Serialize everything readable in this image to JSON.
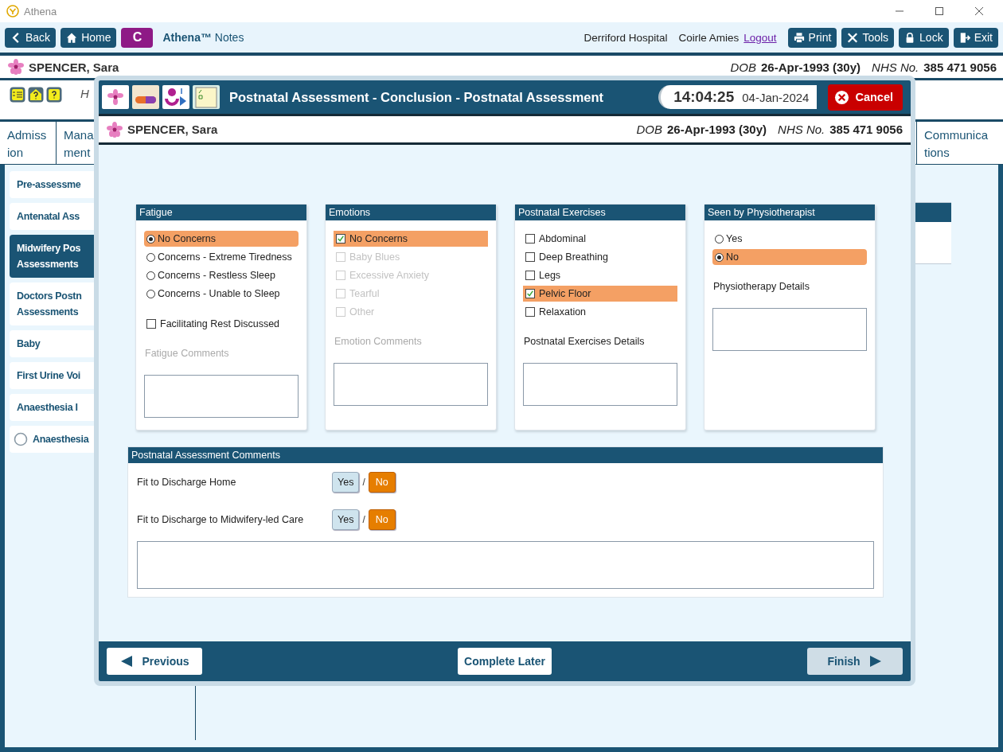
{
  "window": {
    "title": "Athena"
  },
  "toolbar": {
    "back": "Back",
    "home": "Home",
    "c_badge": "C",
    "app_name": "Athena™",
    "app_sub": "Notes",
    "hospital": "Derriford Hospital",
    "user": "Coirle Amies",
    "logout": "Logout",
    "buttons": [
      {
        "kind": "print",
        "label": "Print"
      },
      {
        "kind": "tools",
        "label": "Tools"
      },
      {
        "kind": "lock",
        "label": "Lock"
      },
      {
        "kind": "exit",
        "label": "Exit"
      }
    ]
  },
  "patient": {
    "name": "SPENCER, Sara",
    "dob_label": "DOB",
    "dob": "26-Apr-1993 (30y)",
    "nhs_label": "NHS No.",
    "nhs": "385 471 9056"
  },
  "background_heading": "H",
  "tabs": [
    {
      "lines": [
        "Admiss",
        "ion"
      ]
    },
    {
      "lines": [
        "Mana",
        "ment"
      ]
    }
  ],
  "tabs_right": [
    {
      "lines": [
        "Communica",
        "tions"
      ]
    }
  ],
  "sidebar": {
    "items": [
      {
        "lines": [
          "Pre-assessme"
        ],
        "selected": false,
        "circle": false
      },
      {
        "lines": [
          "Antenatal Ass"
        ],
        "selected": false,
        "circle": false
      },
      {
        "lines": [
          "Midwifery Pos",
          "Assessments"
        ],
        "selected": true,
        "circle": false
      },
      {
        "lines": [
          "Doctors Postn",
          "Assessments"
        ],
        "selected": false,
        "circle": false
      },
      {
        "lines": [
          "Baby"
        ],
        "selected": false,
        "circle": false
      },
      {
        "lines": [
          "First Urine Voi"
        ],
        "selected": false,
        "circle": false
      },
      {
        "lines": [
          "Anaesthesia I"
        ],
        "selected": false,
        "circle": false
      },
      {
        "lines": [
          "Anaesthesia"
        ],
        "selected": false,
        "circle": true
      }
    ]
  },
  "dialog": {
    "title": "Postnatal Assessment - Conclusion - Postnatal Assessment",
    "time": "14:04:25",
    "date": "04-Jan-2024",
    "cancel": "Cancel",
    "patient": {
      "name": "SPENCER, Sara",
      "dob_label": "DOB",
      "dob": "26-Apr-1993 (30y)",
      "nhs_label": "NHS No.",
      "nhs": "385 471 9056"
    },
    "cards": [
      {
        "title": "Fatigue",
        "options": [
          {
            "kind": "radio",
            "label": "No Concerns",
            "selected": true,
            "disabled": false
          },
          {
            "kind": "radio",
            "label": "Concerns - Extreme Tiredness",
            "selected": false,
            "disabled": false
          },
          {
            "kind": "radio",
            "label": "Concerns - Restless Sleep",
            "selected": false,
            "disabled": false
          },
          {
            "kind": "radio",
            "label": "Concerns - Unable to Sleep",
            "selected": false,
            "disabled": false
          }
        ],
        "extra": [
          {
            "label": "Facilitating Rest Discussed",
            "checked": false
          }
        ],
        "details": {
          "label": "Fatigue Comments",
          "disabled": true
        }
      },
      {
        "title": "Emotions",
        "options": [
          {
            "kind": "checkbox",
            "label": "No Concerns",
            "checked": true,
            "disabled": false
          },
          {
            "kind": "checkbox",
            "label": "Baby Blues",
            "checked": false,
            "disabled": true
          },
          {
            "kind": "checkbox",
            "label": "Excessive Anxiety",
            "checked": false,
            "disabled": true
          },
          {
            "kind": "checkbox",
            "label": "Tearful",
            "checked": false,
            "disabled": true
          },
          {
            "kind": "checkbox",
            "label": "Other",
            "checked": false,
            "disabled": true
          }
        ],
        "details": {
          "label": "Emotion Comments",
          "disabled": true
        }
      },
      {
        "title": "Postnatal Exercises",
        "options": [
          {
            "kind": "checkbox",
            "label": "Abdominal",
            "checked": false,
            "disabled": false
          },
          {
            "kind": "checkbox",
            "label": "Deep Breathing",
            "checked": false,
            "disabled": false
          },
          {
            "kind": "checkbox",
            "label": "Legs",
            "checked": false,
            "disabled": false
          },
          {
            "kind": "checkbox",
            "label": "Pelvic Floor",
            "checked": true,
            "disabled": false
          },
          {
            "kind": "checkbox",
            "label": "Relaxation",
            "checked": false,
            "disabled": false
          }
        ],
        "details": {
          "label": "Postnatal Exercises Details",
          "disabled": false
        }
      },
      {
        "title": "Seen by Physiotherapist",
        "options": [
          {
            "kind": "radio",
            "label": "Yes",
            "selected": false,
            "disabled": false
          },
          {
            "kind": "radio",
            "label": "No",
            "selected": true,
            "disabled": false
          }
        ],
        "details": {
          "label": "Physiotherapy Details",
          "disabled": false
        }
      }
    ],
    "comments": {
      "title": "Postnatal Assessment Comments",
      "rows": [
        {
          "label": "Fit to Discharge Home",
          "separator": "/",
          "options": [
            {
              "label": "Yes",
              "selected": false
            },
            {
              "label": "No",
              "selected": true
            }
          ]
        },
        {
          "label": "Fit to Discharge to Midwifery-led Care",
          "separator": "/",
          "options": [
            {
              "label": "Yes",
              "selected": false
            },
            {
              "label": "No",
              "selected": true
            }
          ]
        }
      ]
    },
    "footer": {
      "previous": "Previous",
      "complete_later": "Complete Later",
      "finish": "Finish",
      "finish_disabled": true
    }
  }
}
